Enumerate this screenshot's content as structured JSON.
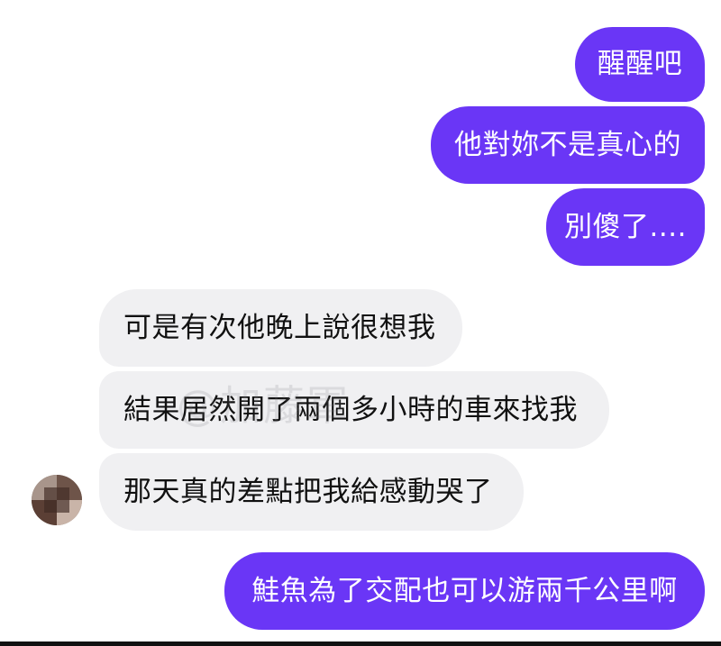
{
  "conversation": {
    "sent_top": [
      {
        "text": "醒醒吧"
      },
      {
        "text": "他對妳不是真心的"
      },
      {
        "text": "別傻了...."
      }
    ],
    "received": [
      {
        "text": "可是有次他晚上說很想我"
      },
      {
        "text": "結果居然開了兩個多小時的車來找我"
      },
      {
        "text": "那天真的差點把我給感動哭了"
      }
    ],
    "sent_bottom": [
      {
        "text": "鮭魚為了交配也可以游兩千公里啊"
      }
    ]
  },
  "watermark": {
    "text": "@加藤軍"
  },
  "colors": {
    "sent_bubble": "#6a36f6",
    "received_bubble": "#f0f0f2",
    "sent_text": "#ffffff",
    "received_text": "#111111"
  },
  "icons": {
    "avatar": "blurred-avatar"
  }
}
